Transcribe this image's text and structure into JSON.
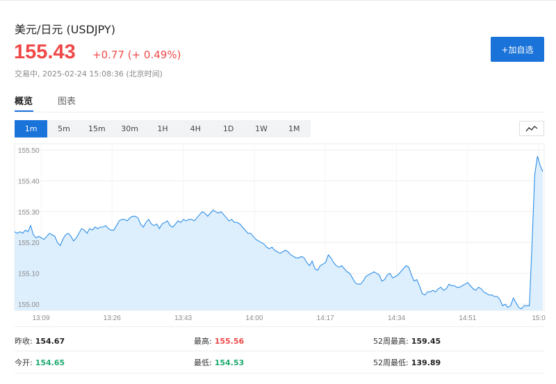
{
  "header": {
    "title": "美元/日元  (USDJPY)",
    "price": "155.43",
    "change": "+0.77 (+ 0.49%)",
    "status": "交易中,  2025-02-24 15:08:36 (北京时间)",
    "add_watchlist": "+加自选"
  },
  "tabs": [
    "概览",
    "图表"
  ],
  "periods": [
    "1m",
    "5m",
    "15m",
    "30m",
    "1H",
    "4H",
    "1D",
    "1W",
    "1M"
  ],
  "colors": {
    "accent": "#1a73d9",
    "up": "#f04848",
    "down": "#1eaa6f",
    "line": "#2d8ee6",
    "fill": "#ddeefc"
  },
  "chart_data": {
    "type": "area",
    "ylim": [
      154.98,
      155.52
    ],
    "yticks": [
      "155.50",
      "155.40",
      "155.30",
      "155.20",
      "155.10",
      "155.00"
    ],
    "xticks": [
      "13:09",
      "13:26",
      "13:43",
      "14:00",
      "14:17",
      "14:34",
      "14:51",
      "15:0"
    ],
    "grid": true,
    "series": [
      {
        "values": [
          155.235,
          155.23,
          155.235,
          155.23,
          155.24,
          155.235,
          155.255,
          155.225,
          155.215,
          155.22,
          155.215,
          155.21,
          155.22,
          155.23,
          155.225,
          155.22,
          155.2,
          155.19,
          155.21,
          155.225,
          155.23,
          155.22,
          155.205,
          155.215,
          155.23,
          155.245,
          155.24,
          155.23,
          155.245,
          155.24,
          155.25,
          155.245,
          155.25,
          155.25,
          155.255,
          155.245,
          155.24,
          155.24,
          155.255,
          155.27,
          155.275,
          155.275,
          155.27,
          155.28,
          155.285,
          155.285,
          155.28,
          155.26,
          155.25,
          155.265,
          155.275,
          155.26,
          155.255,
          155.26,
          155.245,
          155.26,
          155.265,
          155.27,
          155.255,
          155.25,
          155.26,
          155.27,
          155.265,
          155.275,
          155.27,
          155.275,
          155.275,
          155.27,
          155.28,
          155.29,
          155.3,
          155.295,
          155.285,
          155.295,
          155.305,
          155.3,
          155.295,
          155.3,
          155.29,
          155.28,
          155.27,
          155.275,
          155.265,
          155.265,
          155.26,
          155.25,
          155.24,
          155.23,
          155.23,
          155.22,
          155.21,
          155.205,
          155.2,
          155.195,
          155.185,
          155.18,
          155.185,
          155.175,
          155.17,
          155.165,
          155.17,
          155.175,
          155.17,
          155.16,
          155.155,
          155.15,
          155.15,
          155.155,
          155.15,
          155.135,
          155.125,
          155.14,
          155.115,
          155.11,
          155.125,
          155.13,
          155.135,
          155.16,
          155.15,
          155.135,
          155.125,
          155.12,
          155.125,
          155.115,
          155.105,
          155.1,
          155.085,
          155.07,
          155.065,
          155.065,
          155.075,
          155.09,
          155.095,
          155.1,
          155.105,
          155.1,
          155.095,
          155.075,
          155.08,
          155.095,
          155.1,
          155.085,
          155.09,
          155.095,
          155.105,
          155.115,
          155.125,
          155.12,
          155.095,
          155.075,
          155.08,
          155.06,
          155.035,
          155.03,
          155.04,
          155.04,
          155.045,
          155.04,
          155.05,
          155.055,
          155.045,
          155.05,
          155.065,
          155.06,
          155.06,
          155.055,
          155.055,
          155.06,
          155.065,
          155.07,
          155.06,
          155.05,
          155.045,
          155.055,
          155.05,
          155.04,
          155.035,
          155.03,
          155.03,
          155.025,
          155.025,
          155.015,
          154.995,
          155.0,
          154.99,
          154.995,
          155.02,
          155.005,
          154.99,
          154.985,
          154.995,
          154.995,
          154.995,
          155.2,
          155.42,
          155.48,
          155.45,
          155.43
        ]
      }
    ]
  },
  "stats": [
    {
      "label": "昨收:",
      "value": "154.67"
    },
    {
      "label": "最高:",
      "value": "155.56"
    },
    {
      "label": "52周最高:",
      "value": "159.45"
    },
    {
      "label": "今开:",
      "value": "154.65"
    },
    {
      "label": "最低:",
      "value": "154.53"
    },
    {
      "label": "52周最低:",
      "value": "139.89"
    }
  ]
}
